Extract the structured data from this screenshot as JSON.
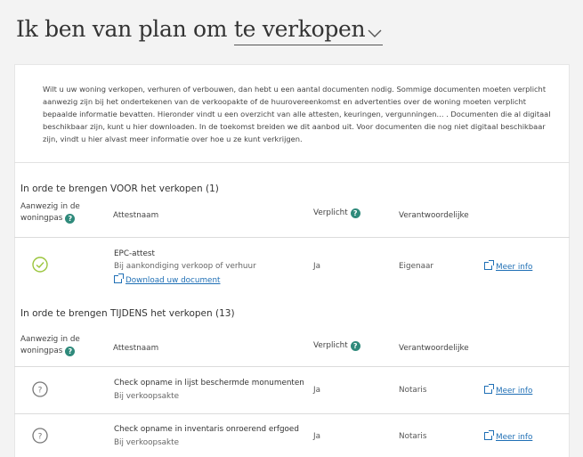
{
  "header": {
    "prefix": "Ik ben van plan om",
    "selected": "te verkopen"
  },
  "intro": "Wilt u uw woning verkopen, verhuren of verbouwen, dan hebt u een aantal documenten nodig. Sommige documenten moeten verplicht aanwezig zijn bij het ondertekenen van de verkoopakte of de huurovereenkomst en advertenties over de woning moeten verplicht bepaalde informatie bevatten. Hieronder vindt u een overzicht van alle attesten, keuringen, vergunningen... . Documenten die al digitaal beschikbaar zijn, kunt u hier downloaden. In de toekomst breiden we dit aanbod uit. Voor documenten die nog niet digitaal beschikbaar zijn, vindt u hier alvast meer informatie over hoe u ze kunt verkrijgen.",
  "columns": {
    "woningpas": "Aanwezig in de woningpas",
    "attestnaam": "Attestnaam",
    "verplicht": "Verplicht",
    "verantwoordelijke": "Verantwoordelijke"
  },
  "sections": [
    {
      "title": "In orde te brengen VOOR het verkopen (1)",
      "rows": [
        {
          "status": "present",
          "name": "EPC-attest",
          "when": "Bij aankondiging verkoop of verhuur",
          "download": "Download uw document",
          "verplicht": "Ja",
          "verantwoordelijke": "Eigenaar",
          "link": "Meer info"
        }
      ]
    },
    {
      "title": "In orde te brengen TIJDENS het verkopen (13)",
      "rows": [
        {
          "status": "unknown",
          "name": "Check opname in lijst beschermde monumenten",
          "when": "Bij verkoopsakte",
          "verplicht": "Ja",
          "verantwoordelijke": "Notaris",
          "link": "Meer info"
        },
        {
          "status": "unknown",
          "name": "Check opname in inventaris onroerend erfgoed",
          "when": "Bij verkoopsakte",
          "verplicht": "Ja",
          "verantwoordelijke": "Notaris",
          "link": "Meer info"
        }
      ]
    }
  ],
  "icons": {
    "help": "?",
    "unknown": "?",
    "accent": "#2f8a7b",
    "check_color": "#9bc53d",
    "link_color": "#1f6fb5"
  }
}
